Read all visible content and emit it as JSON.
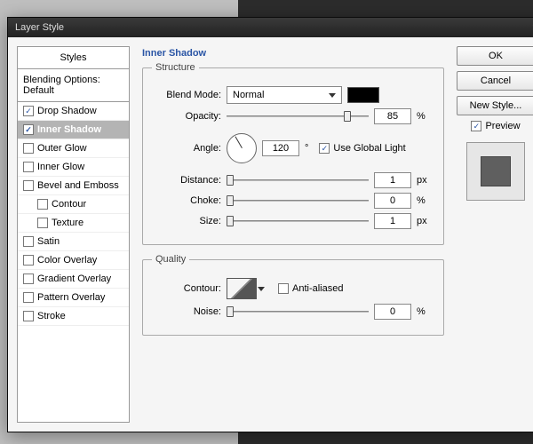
{
  "window": {
    "title": "Layer Style",
    "close": "×"
  },
  "styles": {
    "header": "Styles",
    "blending": "Blending Options: Default",
    "items": [
      {
        "label": "Drop Shadow",
        "checked": true,
        "selected": false,
        "indent": false
      },
      {
        "label": "Inner Shadow",
        "checked": true,
        "selected": true,
        "indent": false
      },
      {
        "label": "Outer Glow",
        "checked": false,
        "selected": false,
        "indent": false
      },
      {
        "label": "Inner Glow",
        "checked": false,
        "selected": false,
        "indent": false
      },
      {
        "label": "Bevel and Emboss",
        "checked": false,
        "selected": false,
        "indent": false
      },
      {
        "label": "Contour",
        "checked": false,
        "selected": false,
        "indent": true
      },
      {
        "label": "Texture",
        "checked": false,
        "selected": false,
        "indent": true
      },
      {
        "label": "Satin",
        "checked": false,
        "selected": false,
        "indent": false
      },
      {
        "label": "Color Overlay",
        "checked": false,
        "selected": false,
        "indent": false
      },
      {
        "label": "Gradient Overlay",
        "checked": false,
        "selected": false,
        "indent": false
      },
      {
        "label": "Pattern Overlay",
        "checked": false,
        "selected": false,
        "indent": false
      },
      {
        "label": "Stroke",
        "checked": false,
        "selected": false,
        "indent": false
      }
    ]
  },
  "section": {
    "title": "Inner Shadow",
    "structure": {
      "legend": "Structure",
      "blendModeLabel": "Blend Mode:",
      "blendMode": "Normal",
      "color": "#000000",
      "opacityLabel": "Opacity:",
      "opacity": "85",
      "opacityUnit": "%",
      "angleLabel": "Angle:",
      "angle": "120",
      "angleUnit": "°",
      "globalLightLabel": "Use Global Light",
      "globalLight": true,
      "distanceLabel": "Distance:",
      "distance": "1",
      "distanceUnit": "px",
      "chokeLabel": "Choke:",
      "choke": "0",
      "chokeUnit": "%",
      "sizeLabel": "Size:",
      "size": "1",
      "sizeUnit": "px"
    },
    "quality": {
      "legend": "Quality",
      "contourLabel": "Contour:",
      "antiAliasedLabel": "Anti-aliased",
      "antiAliased": false,
      "noiseLabel": "Noise:",
      "noise": "0",
      "noiseUnit": "%"
    }
  },
  "buttons": {
    "ok": "OK",
    "cancel": "Cancel",
    "newStyle": "New Style...",
    "previewLabel": "Preview",
    "preview": true
  }
}
